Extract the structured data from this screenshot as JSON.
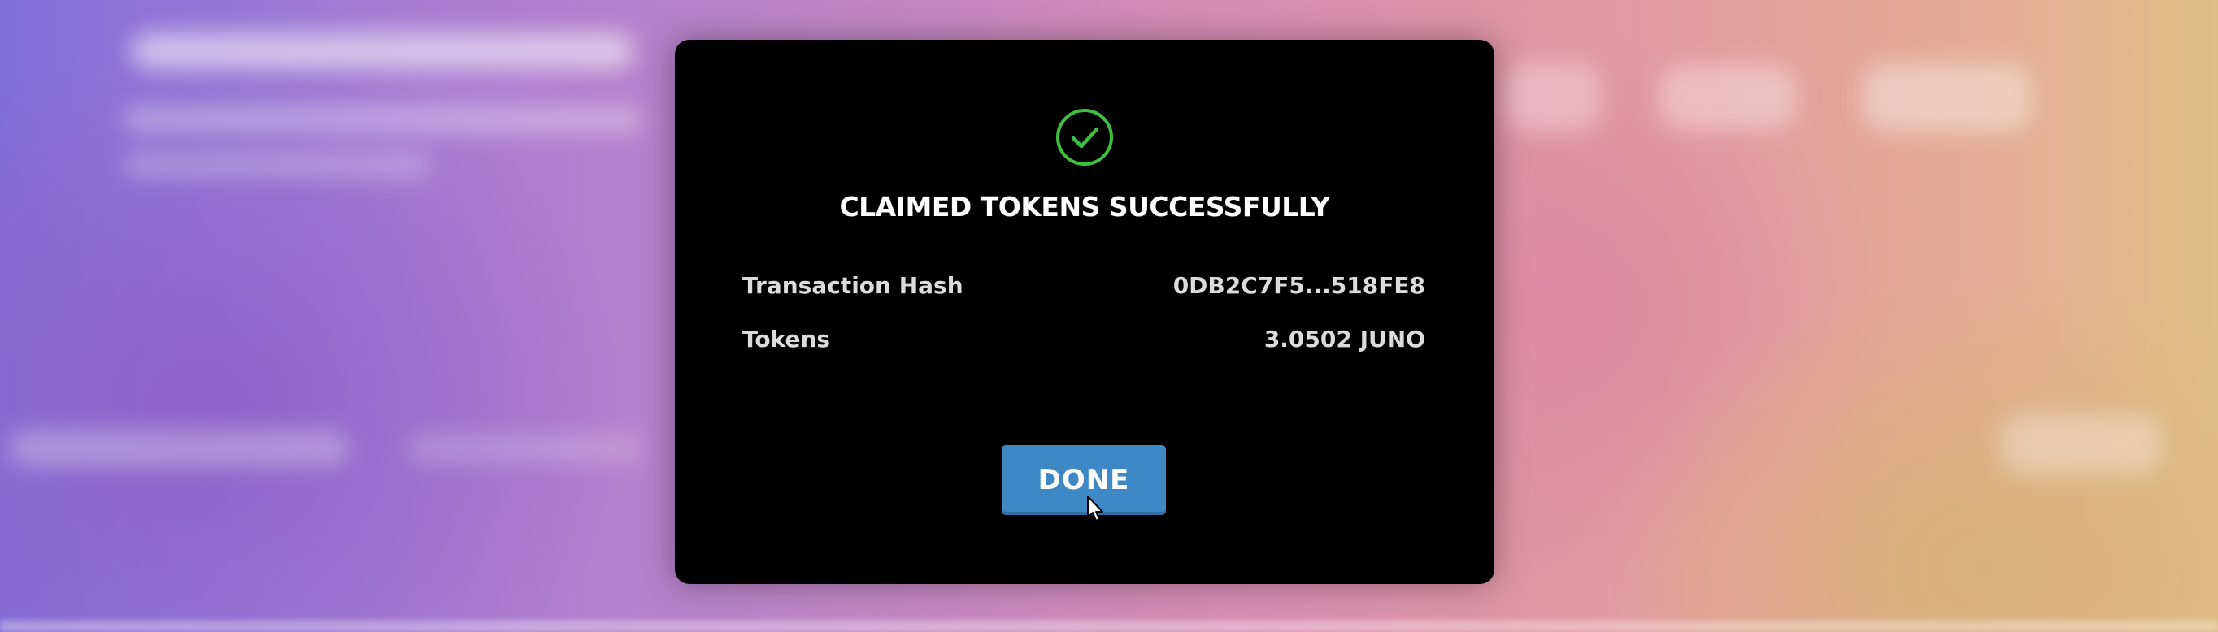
{
  "modal": {
    "icon": "check-circle-icon",
    "title": "CLAIMED TOKENS SUCCESSFULLY",
    "details": [
      {
        "label": "Transaction Hash",
        "value": "0DB2C7F5...518FE8"
      },
      {
        "label": "Tokens",
        "value": "3.0502 JUNO"
      }
    ],
    "done_label": "DONE"
  },
  "colors": {
    "modal_background": "#000000",
    "success_green": "#3fbf3f",
    "button_blue": "#3f88c6",
    "text": "#dcdcdc"
  },
  "cursor": "mouse-pointer-icon"
}
